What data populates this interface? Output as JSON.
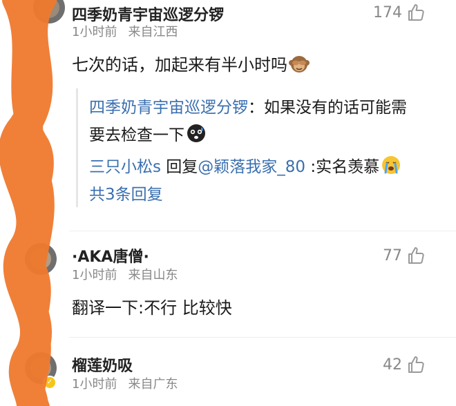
{
  "comments": [
    {
      "username": "四季奶青宇宙巡逻分锣",
      "time": "1小时前",
      "location": "来自江西",
      "likes": "174",
      "text": "七次的话，加起来有半小时吗",
      "emoji": "monkey-covering-eyes-emoji",
      "replies": [
        {
          "name": "四季奶青宇宙巡逻分锣",
          "text_line1": "：如果没有的话可能需",
          "text_line2": "要去检查一下",
          "emoji": "anxious-face-emoji"
        },
        {
          "name": "三只小松s",
          "reply_word": "回复",
          "target": "@颖落我家_80",
          "text": ":实名羡慕",
          "emoji": "loudly-crying-face-emoji"
        }
      ],
      "more_replies": "共3条回复"
    },
    {
      "username": "·AKA唐僧·",
      "time": "1小时前",
      "location": "来自山东",
      "likes": "77",
      "text": "翻译一下:不行 比较快"
    },
    {
      "username": "榴莲奶吸",
      "time": "1小时前",
      "location": "来自广东",
      "likes": "42",
      "badge": "verified"
    }
  ],
  "colors": {
    "link": "#3a6fb0",
    "meta": "#888888",
    "scribble": "#f07a2e"
  },
  "icons": {
    "like": "thumbs-up-icon"
  }
}
